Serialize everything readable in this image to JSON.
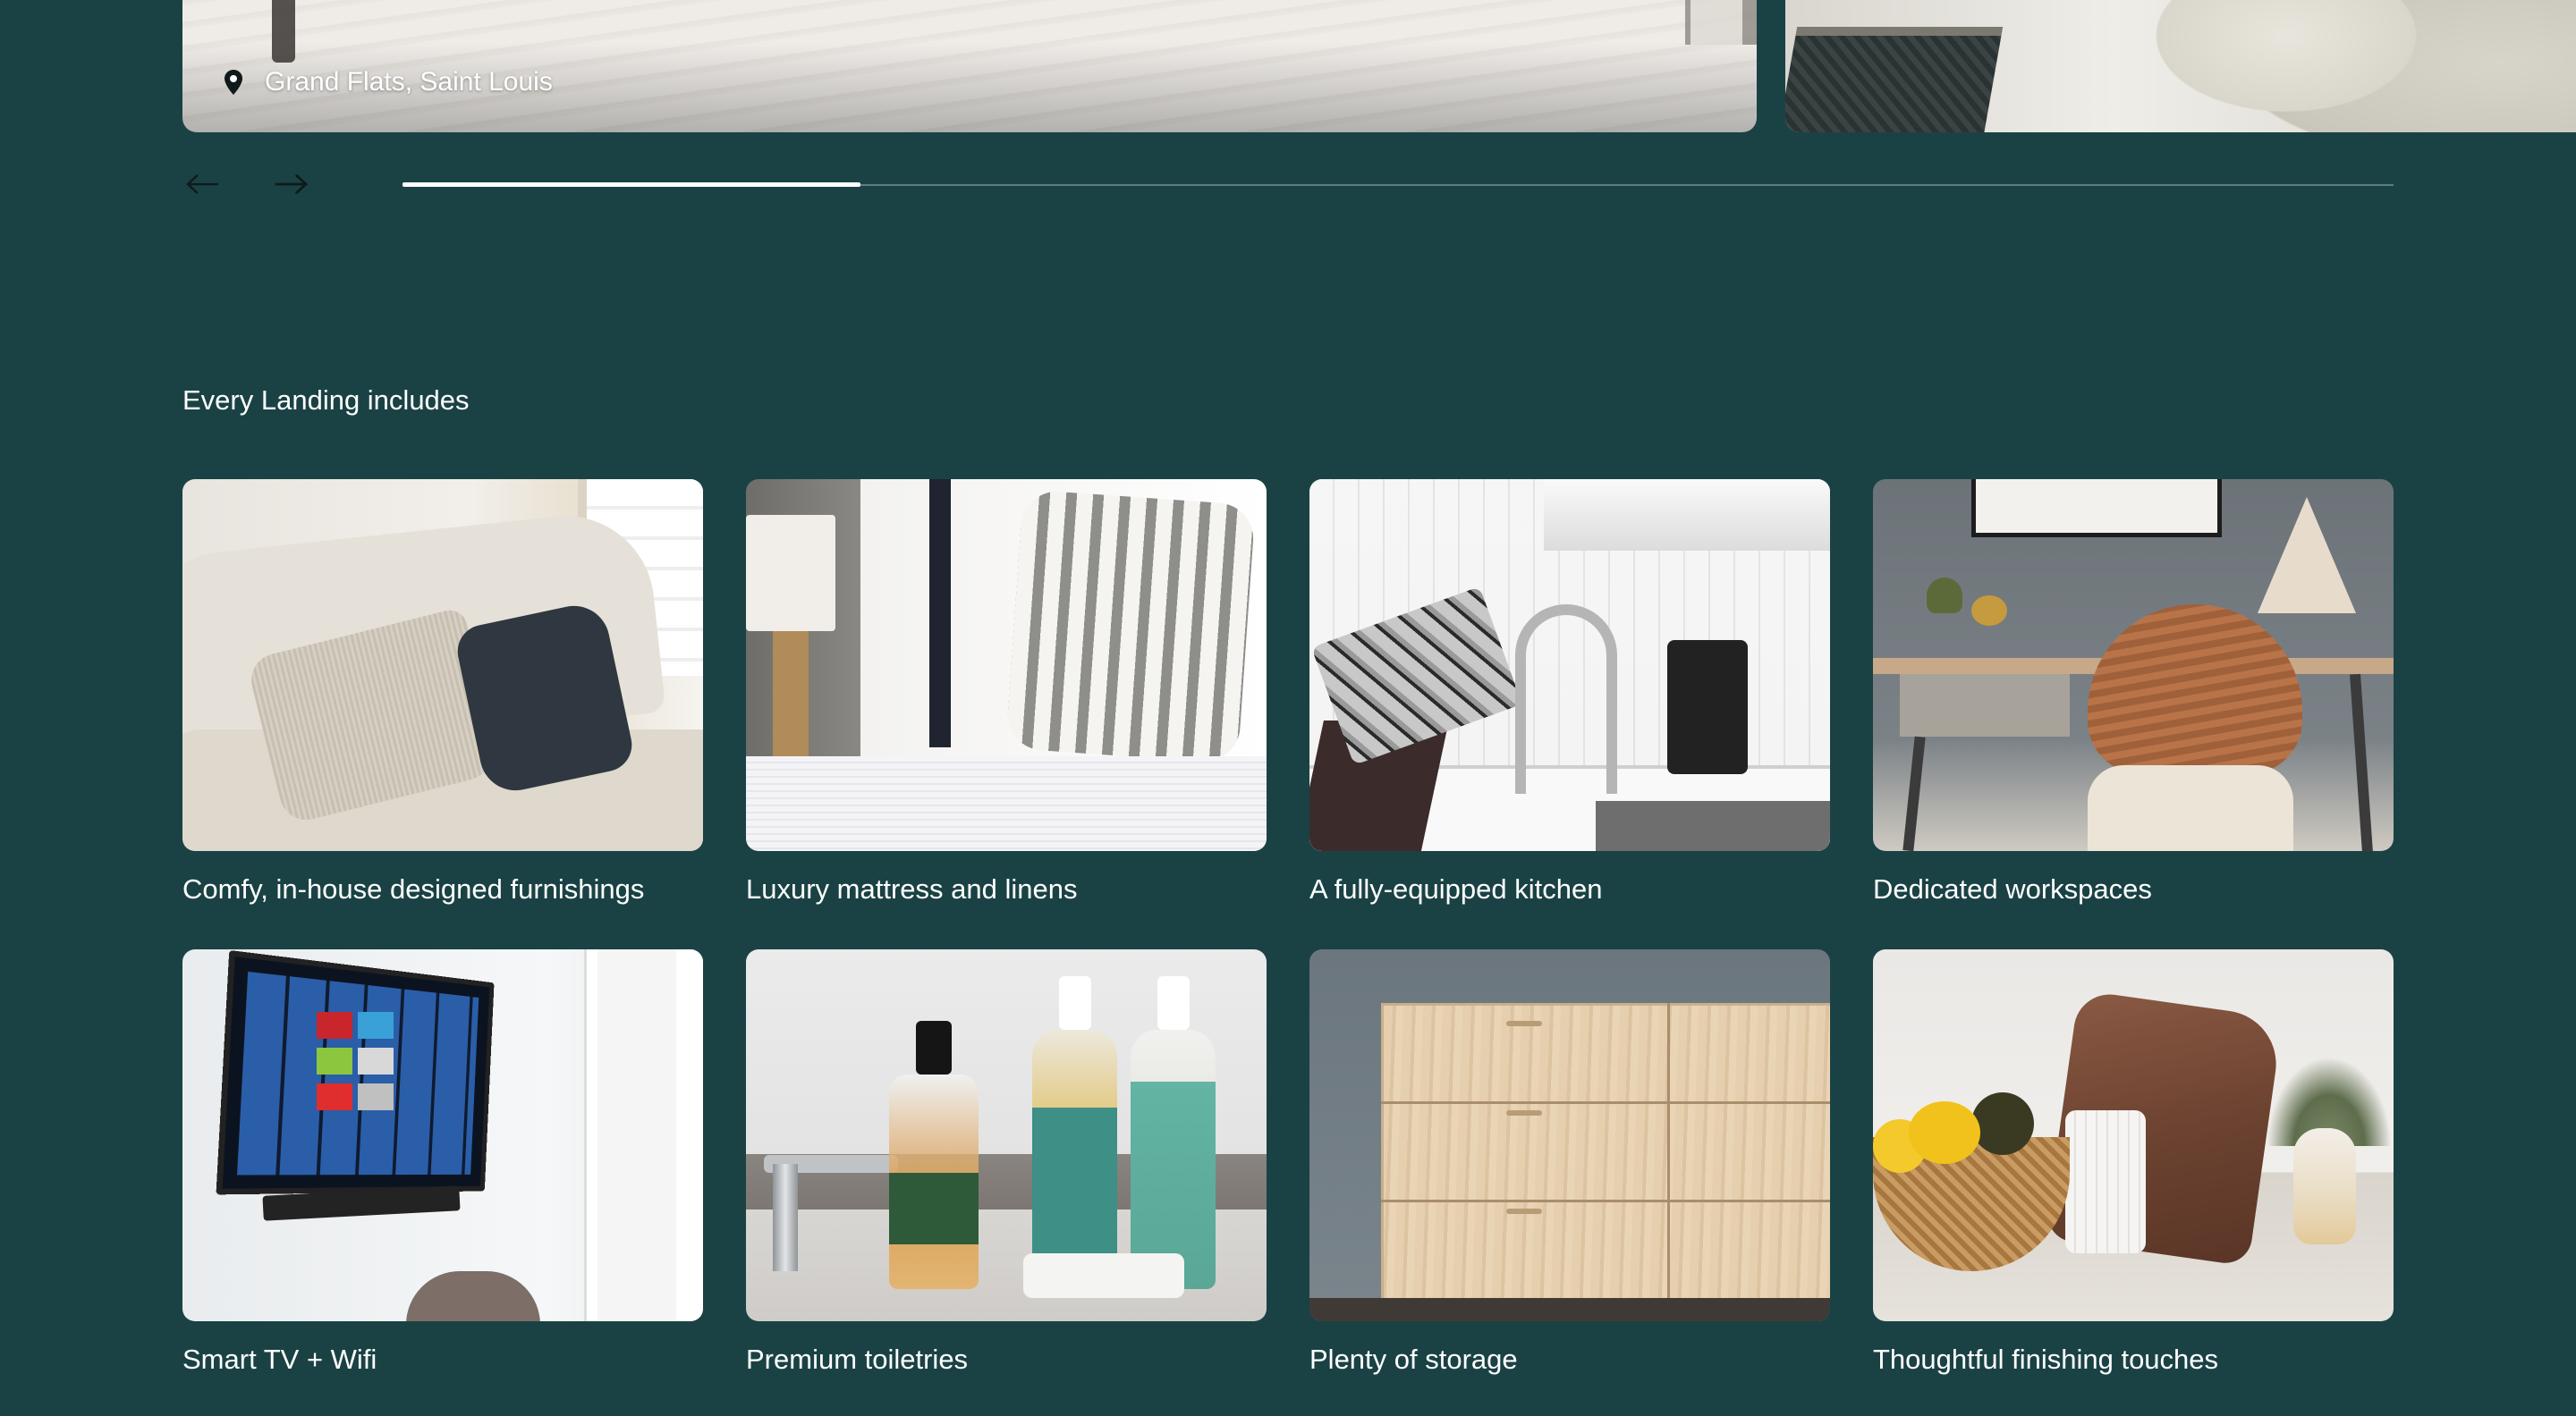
{
  "carousel": {
    "location": "Grand Flats, Saint Louis",
    "progress_fraction": 0.23
  },
  "icons": {
    "pin": "map-pin-icon",
    "prev": "arrow-left-icon",
    "next": "arrow-right-icon"
  },
  "colors": {
    "background": "#1a4244",
    "text": "#ffffff",
    "track": "#5e7d7e"
  },
  "amenities": {
    "heading": "Every Landing includes",
    "items": [
      {
        "label": "Comfy, in-house designed furnishings"
      },
      {
        "label": "Luxury mattress and linens"
      },
      {
        "label": "A fully-equipped kitchen"
      },
      {
        "label": "Dedicated workspaces"
      },
      {
        "label": "Smart TV + Wifi"
      },
      {
        "label": "Premium toiletries"
      },
      {
        "label": "Plenty of storage"
      },
      {
        "label": "Thoughtful finishing touches"
      }
    ]
  }
}
